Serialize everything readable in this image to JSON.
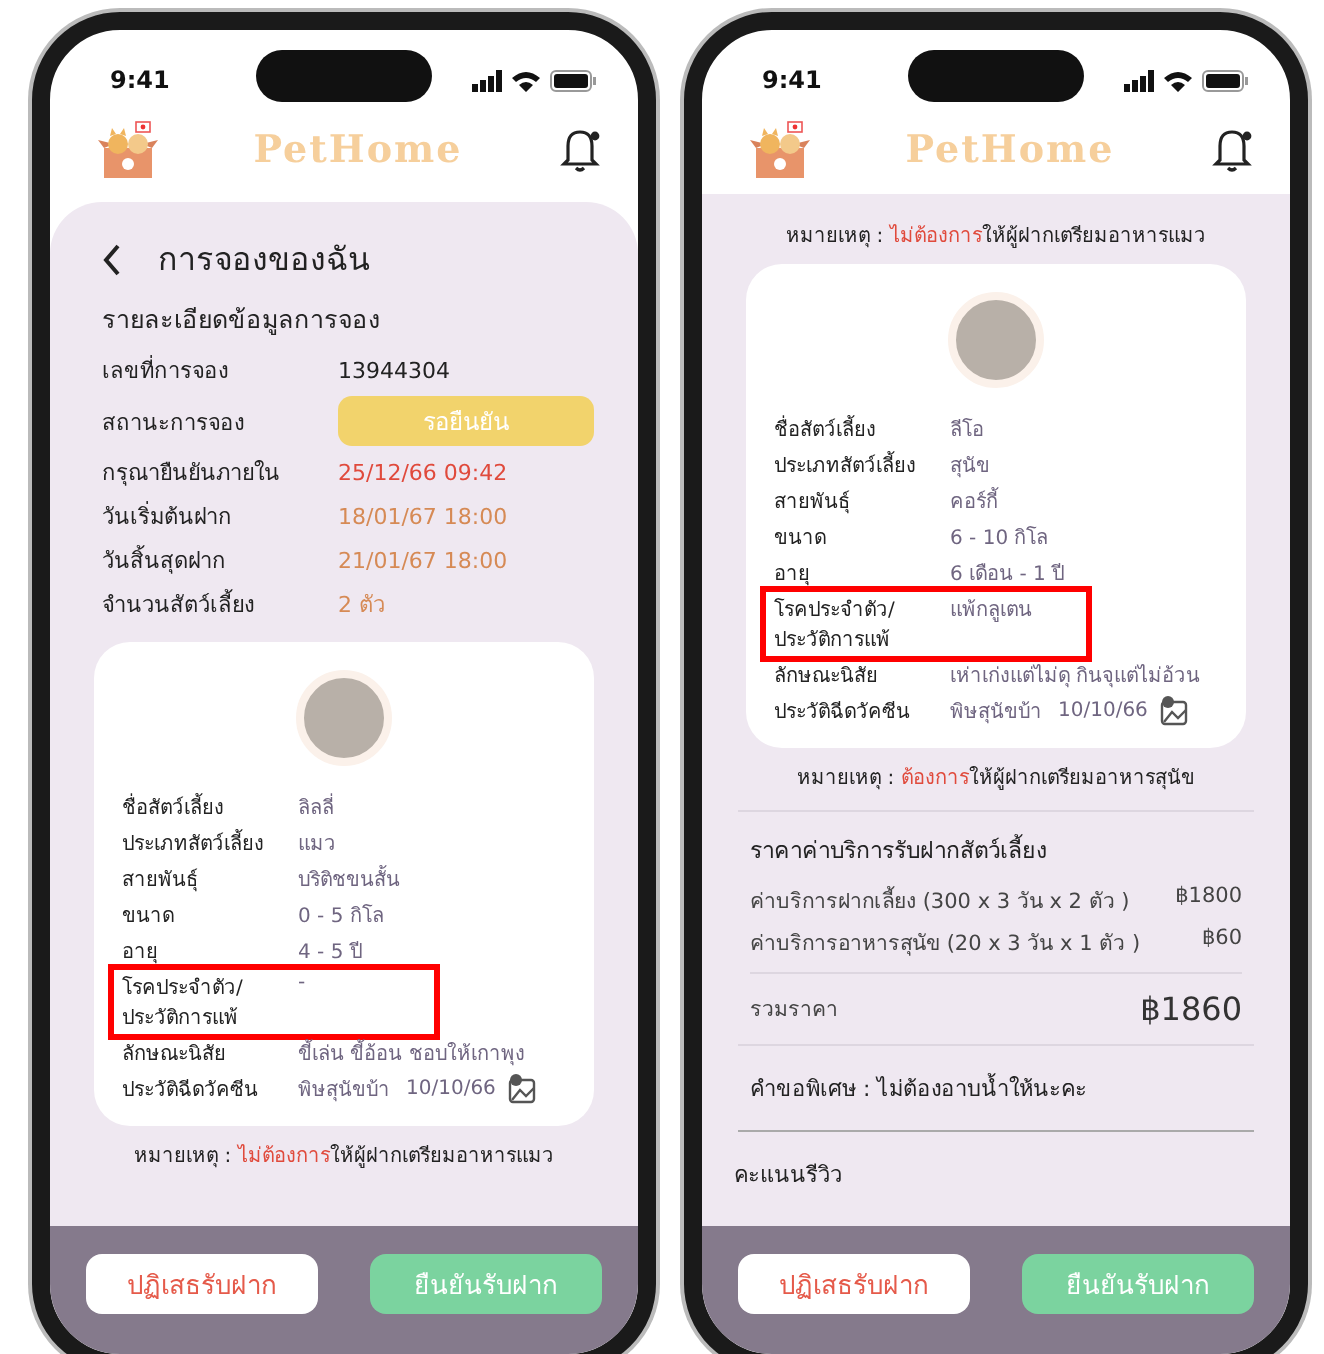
{
  "phones": [
    {
      "status_time": "9:41",
      "logo": "PetHome",
      "blocks": [
        {
          "kind": "page_title",
          "text": "การจองของฉัน"
        },
        {
          "kind": "section_title",
          "text": "รายละเอียดข้อมูลการจอง"
        },
        {
          "kind": "info_rows",
          "rows": [
            {
              "label": "เลขที่การจอง",
              "value": "13944304",
              "kind": "text",
              "color": "#222222"
            },
            {
              "label": "สถานะการจอง",
              "value": "รอยืนยัน",
              "kind": "badge",
              "color": "#f2d36c"
            },
            {
              "label": "กรุณายืนยันภายใน",
              "value": "25/12/66 09:42",
              "kind": "text",
              "color": "#e04a3c"
            },
            {
              "label": "วันเริ่มต้นฝาก",
              "value": "18/01/67 18:00",
              "kind": "text",
              "color": "#d68a55"
            },
            {
              "label": "วันสิ้นสุดฝาก",
              "value": "21/01/67 18:00",
              "kind": "text",
              "color": "#d68a55"
            },
            {
              "label": "จำนวนสัตว์เลี้ยง",
              "value": "2 ตัว",
              "kind": "text",
              "color": "#d68a55"
            }
          ]
        },
        {
          "kind": "pet_card",
          "fields": [
            {
              "label": "ชื่อสัตว์เลี้ยง",
              "value": "ลิลลี่",
              "highlighted": false
            },
            {
              "label": "ประเภทสัตว์เลี้ยง",
              "value": "แมว",
              "highlighted": false
            },
            {
              "label": "สายพันธุ์",
              "value": "บริติชขนสั้น",
              "highlighted": false
            },
            {
              "label": "ขนาด",
              "value": "0 - 5 กิโล",
              "highlighted": false
            },
            {
              "label": "อายุ",
              "value": "4 - 5 ปี",
              "highlighted": false
            },
            {
              "label": "โรคประจำตัว/\nประวัติการแพ้",
              "value": "-",
              "highlighted": true
            },
            {
              "label": "ลักษณะนิสัย",
              "value": "ขี้เล่น ขี้อ้อน ชอบให้เกาพุง",
              "highlighted": false
            },
            {
              "label": "ประวัติฉีดวัคซีน",
              "value": "พิษสุนัขบ้า",
              "date": "10/10/66",
              "highlighted": false
            }
          ]
        },
        {
          "kind": "note",
          "label": "หมายเหตุ :",
          "highlight": "ไม่ต้องการ",
          "rest": "ให้ผู้ฝากเตรียมอาหารแมว"
        }
      ],
      "buttons": [
        {
          "label": "ปฏิเสธรับฝาก",
          "kind": "reject"
        },
        {
          "label": "ยืนยันรับฝาก",
          "kind": "confirm"
        }
      ]
    },
    {
      "status_time": "9:41",
      "logo": "PetHome",
      "blocks": [
        {
          "kind": "note",
          "label": "หมายเหตุ :",
          "highlight": "ไม่ต้องการ",
          "rest": "ให้ผู้ฝากเตรียมอาหารแมว"
        },
        {
          "kind": "pet_card",
          "fields": [
            {
              "label": "ชื่อสัตว์เลี้ยง",
              "value": "ลีโอ",
              "highlighted": false
            },
            {
              "label": "ประเภทสัตว์เลี้ยง",
              "value": "สุนัข",
              "highlighted": false
            },
            {
              "label": "สายพันธุ์",
              "value": "คอร์กี้",
              "highlighted": false
            },
            {
              "label": "ขนาด",
              "value": "6 - 10 กิโล",
              "highlighted": false
            },
            {
              "label": "อายุ",
              "value": "6 เดือน - 1 ปี",
              "highlighted": false
            },
            {
              "label": "โรคประจำตัว/\nประวัติการแพ้",
              "value": "แพ้กลูเตน",
              "highlighted": true
            },
            {
              "label": "ลักษณะนิสัย",
              "value": "เห่าเก่งแต่ไม่ดุ กินจุแต่ไม่อ้วน",
              "highlighted": false
            },
            {
              "label": "ประวัติฉีดวัคซีน",
              "value": "พิษสุนัขบ้า",
              "date": "10/10/66",
              "highlighted": false
            }
          ]
        },
        {
          "kind": "note",
          "label": "หมายเหตุ :",
          "highlight": "ต้องการ",
          "rest": "ให้ผู้ฝากเตรียมอาหารสุนัข"
        },
        {
          "kind": "price",
          "title": "ราคาค่าบริการรับฝากสัตว์เลี้ยง",
          "lines": [
            {
              "label": "ค่าบริการฝากเลี้ยง (300 x 3 วัน x 2 ตัว )",
              "amount": "฿1800"
            },
            {
              "label": "ค่าบริการอาหารสุนัข (20 x 3 วัน x 1 ตัว )",
              "amount": "฿60"
            }
          ],
          "total_label": "รวมราคา",
          "total": "฿1860"
        },
        {
          "kind": "special",
          "text": "คำขอพิเศษ : ไม่ต้องอาบน้ำให้นะคะ"
        },
        {
          "kind": "review",
          "text": "คะแนนรีวิว"
        }
      ],
      "buttons": [
        {
          "label": "ปฏิเสธรับฝาก",
          "kind": "reject"
        },
        {
          "label": "ยืนยันรับฝาก",
          "kind": "confirm"
        }
      ]
    }
  ]
}
